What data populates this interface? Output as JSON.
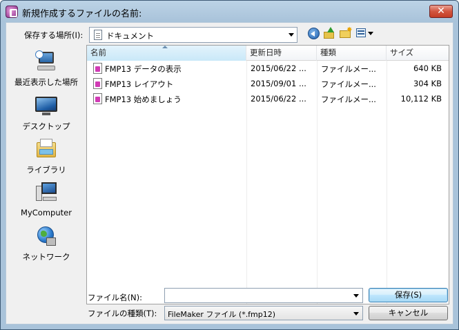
{
  "window": {
    "title": "新規作成するファイルの名前:",
    "close_label": "✕"
  },
  "location": {
    "label": "保存する場所(I):",
    "value": "ドキュメント"
  },
  "toolbar": {
    "icons": [
      "back-icon",
      "up-folder-icon",
      "new-folder-icon",
      "views-menu-icon"
    ]
  },
  "places": [
    {
      "label": "最近表示した場所",
      "icon": "recent-places-icon"
    },
    {
      "label": "デスクトップ",
      "icon": "desktop-icon"
    },
    {
      "label": "ライブラリ",
      "icon": "libraries-icon"
    },
    {
      "label": "MyComputer",
      "icon": "computer-icon"
    },
    {
      "label": "ネットワーク",
      "icon": "network-icon"
    }
  ],
  "columns": {
    "name": "名前",
    "date": "更新日時",
    "kind": "種類",
    "size": "サイズ"
  },
  "files": [
    {
      "name": "FMP13 データの表示",
      "date": "2015/06/22 ...",
      "kind": "ファイルメー...",
      "size": "640 KB"
    },
    {
      "name": "FMP13 レイアウト",
      "date": "2015/09/01 ...",
      "kind": "ファイルメー...",
      "size": "304 KB"
    },
    {
      "name": "FMP13 始めましょう",
      "date": "2015/06/22 ...",
      "kind": "ファイルメー...",
      "size": "10,112 KB"
    }
  ],
  "form": {
    "filename_label": "ファイル名(N):",
    "filename_value": "",
    "filetype_label": "ファイルの種類(T):",
    "filetype_value": "FileMaker ファイル (*.fmp12)"
  },
  "buttons": {
    "save": "保存(S)",
    "cancel": "キャンセル"
  },
  "colors": {
    "title_gradient": "#bcd3e6",
    "close_red": "#c43d25",
    "header_selected": "#c9e8f8",
    "filemaker_pink": "#d13bb5"
  }
}
